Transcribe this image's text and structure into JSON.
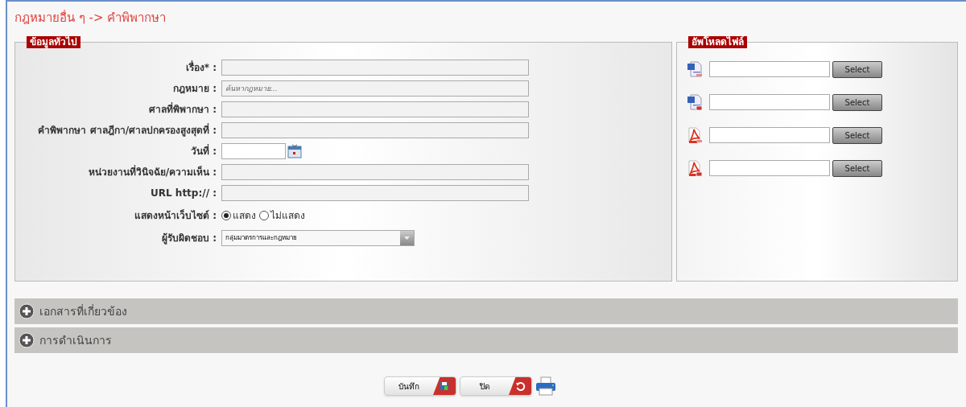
{
  "breadcrumb": "กฎหมายอื่น ๆ -> คำพิพากษา",
  "general": {
    "legend": "ข้อมูลทั่วไป",
    "fields": [
      {
        "kind": "text",
        "label": "เรื่อง* :"
      },
      {
        "kind": "text",
        "label": "กฎหมาย :",
        "placeholder": "ค้นหากฎหมาย..."
      },
      {
        "kind": "text",
        "label": "ศาลที่พิพากษา :"
      },
      {
        "kind": "text",
        "label": "คำพิพากษา ศาลฎีกา/ศาลปกครองสูงสุดที่ :"
      },
      {
        "kind": "date",
        "label": "วันที่ :"
      },
      {
        "kind": "text",
        "label": "หน่วยงานที่วินิจฉัย/ความเห็น :"
      },
      {
        "kind": "text",
        "label": "URL http:// :"
      },
      {
        "kind": "radio",
        "label": "แสดงหน้าเว็บไซต์ :",
        "options": [
          {
            "label": "แสดง",
            "selected": true
          },
          {
            "label": "ไม่แสดง",
            "selected": false
          }
        ]
      },
      {
        "kind": "select",
        "label": "ผู้รับผิดชอบ :",
        "value": "กลุ่มมาตรการและกฎหมาย"
      }
    ]
  },
  "upload": {
    "legend": "อัพโหลดไฟล์",
    "files": [
      {
        "kind": "word",
        "button": "Select"
      },
      {
        "kind": "word-flag",
        "button": "Select"
      },
      {
        "kind": "pdf",
        "button": "Select"
      },
      {
        "kind": "pdf-flag",
        "button": "Select"
      }
    ]
  },
  "sections": [
    {
      "label": "เอกสารที่เกี่ยวข้อง",
      "expanded": false
    },
    {
      "label": "การดำเนินการ",
      "expanded": false
    }
  ],
  "actions": [
    {
      "kind": "save",
      "label": "บันทึก"
    },
    {
      "kind": "close",
      "label": "ปิด"
    }
  ]
}
